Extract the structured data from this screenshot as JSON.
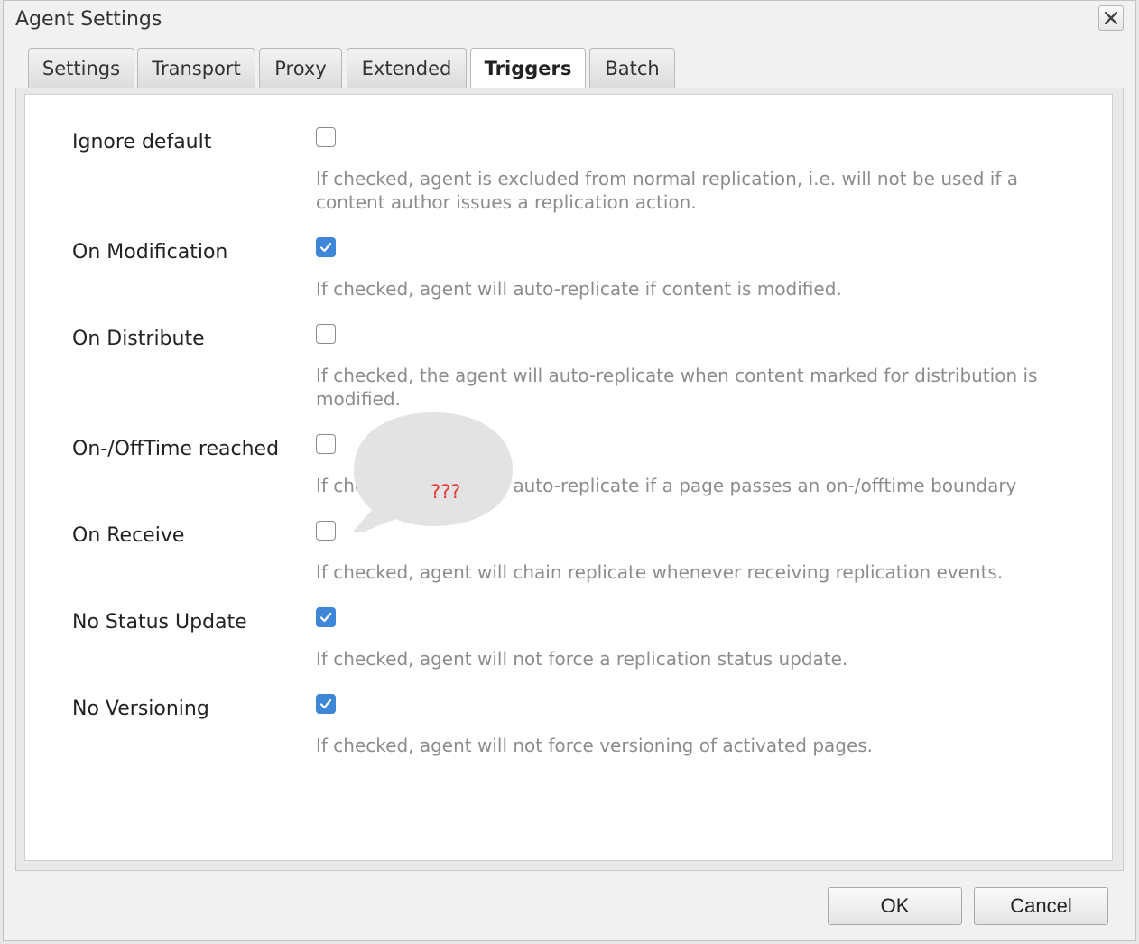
{
  "dialog": {
    "title": "Agent Settings",
    "close_icon": "close-icon"
  },
  "tabs": [
    {
      "label": "Settings",
      "active": false
    },
    {
      "label": "Transport",
      "active": false
    },
    {
      "label": "Proxy",
      "active": false
    },
    {
      "label": "Extended",
      "active": false
    },
    {
      "label": "Triggers",
      "active": true
    },
    {
      "label": "Batch",
      "active": false
    }
  ],
  "triggers": [
    {
      "label": "Ignore default",
      "checked": false,
      "description": "If checked, agent is excluded from normal replication, i.e. will not be used if a content author issues a replication action."
    },
    {
      "label": "On Modification",
      "checked": true,
      "description": "If checked, agent will auto-replicate if content is modified."
    },
    {
      "label": "On Distribute",
      "checked": false,
      "description": "If checked, the agent will auto-replicate when content marked for distribution is modified."
    },
    {
      "label": "On-/OffTime reached",
      "checked": false,
      "description": "If checked, agent will auto-replicate if a page passes an on-/offtime boundary"
    },
    {
      "label": "On Receive",
      "checked": false,
      "description": "If checked, agent will chain replicate whenever receiving replication events."
    },
    {
      "label": "No Status Update",
      "checked": true,
      "description": "If checked, agent will not force a replication status update."
    },
    {
      "label": "No Versioning",
      "checked": true,
      "description": "If checked, agent will not force versioning of activated pages."
    }
  ],
  "annotation": {
    "text": "???",
    "color": "#e53935"
  },
  "buttons": {
    "ok": "OK",
    "cancel": "Cancel"
  },
  "colors": {
    "checkbox_checked": "#3d86d8"
  }
}
